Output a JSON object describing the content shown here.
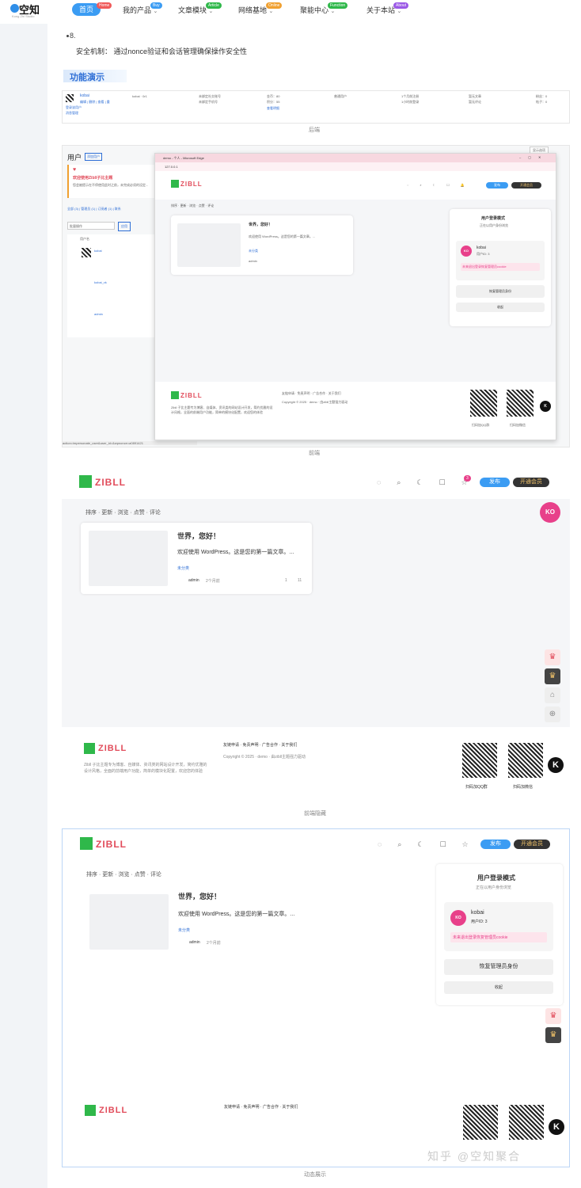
{
  "header": {
    "logo_text": "空知",
    "logo_sub": "Kong Zhi Studio",
    "nav": [
      {
        "label": "首页",
        "badge": "Home"
      },
      {
        "label": "我的产品",
        "badge": "Buy"
      },
      {
        "label": "文章模块",
        "badge": "Article"
      },
      {
        "label": "网络基地",
        "badge": "Online"
      },
      {
        "label": "聚能中心",
        "badge": "Function"
      },
      {
        "label": "关于本站",
        "badge": "About"
      }
    ],
    "colors": {
      "home": "#3b9cf3",
      "buy": "#3b9cf3",
      "article": "#2fb84a",
      "online": "#f0a030",
      "function": "#2fb84a",
      "about": "#9b59e6"
    }
  },
  "content": {
    "item_number": "8.",
    "security": "安全机制：  通过nonce验证和会话管理确保操作安全性",
    "section_title": "功能演示",
    "captions": [
      "后端",
      "前端",
      "前端隐藏",
      "动态展示"
    ]
  },
  "backend": {
    "row_user": "kobai",
    "row_id": "kobai · 0r1",
    "row_actions": "编辑 | 删除 | 查看 | 重",
    "row_login": "登录该用户",
    "row_msg": "消息管理",
    "cols": [
      "未绑定社交账号",
      "未绑定手机号",
      "金币：80",
      "积分：55",
      "查看明细",
      "普通用户",
      "1个月前注册",
      "1小时前登录",
      "暂无文章",
      "暂无评论",
      "粉丝：0",
      "帖子：0"
    ]
  },
  "frontend_window": {
    "title": "demo - 个人 - Microsoft Edge",
    "url": "127.0.0.1",
    "wp_users_title": "用户",
    "wp_add": "添加用户",
    "wp_welcome": "欢迎使用Zibll子比主题",
    "wp_welcome_sub": "您会被提示在不停使用此时之前，未完成必须的设定...",
    "wp_filters": "全部 (3) | 管理员 (1) | 订阅者 (1) | 联系",
    "wp_bulk": "批量操作",
    "wp_apply": "应用",
    "wp_change": "将角色变",
    "wp_users": [
      "kobai",
      "kobai_vk",
      "admin"
    ],
    "wp_username": "用户名",
    "wp_status": "action=impersonate_user&user_id=&wpnonce=a0891421",
    "screen_options": "显示选项"
  },
  "site": {
    "logo": "ZIBLL",
    "tabs": [
      "排序",
      "更新",
      "浏览",
      "点赞",
      "评论"
    ],
    "post_title": "世界，您好！",
    "post_excerpt": "欢迎使用 WordPress。这是您的第一篇文章。...",
    "post_tag": "未分类",
    "post_author": "admin",
    "post_time": "2个月前",
    "post_comments": "1",
    "post_views": "11",
    "post_likes": "1",
    "btn_publish": "发布",
    "btn_vip": "开通会员",
    "notify_count": "3",
    "ko": "KO",
    "ko_badge": "1",
    "footer_links": [
      "友链申请",
      "免责声明",
      "广告合作",
      "关于我们"
    ],
    "footer_copy": "Copyright © 2025 · demo · 由zibll主题强力驱动",
    "footer_desc": "Zibll 子比主题专为博客、自媒体、资讯类的网站设计开发，简约优雅的设计风格，全面的前端用户功能，简单的模块化配置，欢迎您的体验",
    "qr_labels": [
      "扫码加QQ群",
      "扫码加微信"
    ],
    "k_label": "K"
  },
  "login_panel": {
    "title": "用户登录模式",
    "subtitle": "正在以用户身份浏览",
    "user": "kobai",
    "user_id": "用户ID: 3",
    "warning": "未来退出登录恢复管理员cookie",
    "restore": "恢复管理员身份",
    "collapse": "收起"
  },
  "watermark": "知乎 @空知聚合"
}
